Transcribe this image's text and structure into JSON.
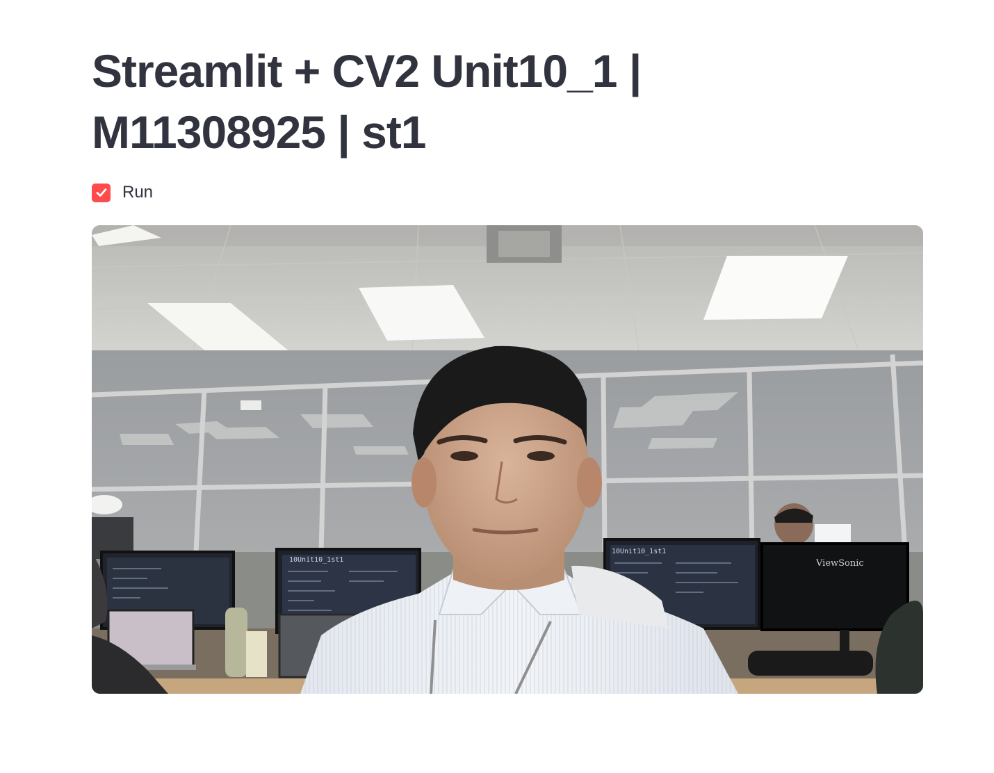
{
  "page": {
    "title": "Streamlit + CV2 Unit10_1 | M11308925 | st1"
  },
  "run_checkbox": {
    "label": "Run",
    "checked": true,
    "accent_color": "#ff4b4b"
  },
  "video_frame": {
    "screen_text_left": "10Unit10_1st1",
    "screen_text_right": "10Unit10_1st1",
    "monitor_brand": "ViewSonic"
  }
}
